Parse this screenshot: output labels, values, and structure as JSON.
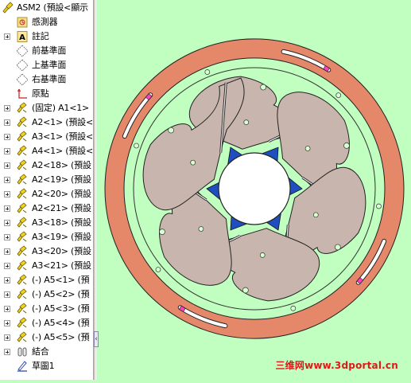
{
  "tree": {
    "items": [
      {
        "label": "ASM2 (預設<顯示",
        "icon": "assembly-icon",
        "expander": "none"
      },
      {
        "label": "感測器",
        "icon": "sensors-icon",
        "expander": "none"
      },
      {
        "label": "註記",
        "icon": "annotations-icon",
        "expander": "plus"
      },
      {
        "label": "前基準面",
        "icon": "plane-icon",
        "expander": "none"
      },
      {
        "label": "上基準面",
        "icon": "plane-icon",
        "expander": "none"
      },
      {
        "label": "右基準面",
        "icon": "plane-icon",
        "expander": "none"
      },
      {
        "label": "原點",
        "icon": "origin-icon",
        "expander": "none"
      },
      {
        "label": "(固定) A1<1>",
        "icon": "part-icon",
        "expander": "plus"
      },
      {
        "label": "A2<1> (預設<",
        "icon": "part-icon",
        "expander": "plus"
      },
      {
        "label": "A3<1> (預設<",
        "icon": "part-icon",
        "expander": "plus"
      },
      {
        "label": "A4<1> (預設<",
        "icon": "part-icon",
        "expander": "plus"
      },
      {
        "label": "A2<18> (預設",
        "icon": "part-icon",
        "expander": "plus"
      },
      {
        "label": "A2<19> (預設",
        "icon": "part-icon",
        "expander": "plus"
      },
      {
        "label": "A2<20> (預設",
        "icon": "part-icon",
        "expander": "plus"
      },
      {
        "label": "A2<21> (預設",
        "icon": "part-icon",
        "expander": "plus"
      },
      {
        "label": "A3<18> (預設",
        "icon": "part-icon",
        "expander": "plus"
      },
      {
        "label": "A3<19> (預設",
        "icon": "part-icon",
        "expander": "plus"
      },
      {
        "label": "A3<20> (預設",
        "icon": "part-icon",
        "expander": "plus"
      },
      {
        "label": "A3<21> (預設",
        "icon": "part-icon",
        "expander": "plus"
      },
      {
        "label": "(-) A5<1> (預",
        "icon": "part-icon",
        "expander": "plus"
      },
      {
        "label": "(-) A5<2> (預",
        "icon": "part-icon",
        "expander": "plus"
      },
      {
        "label": "(-) A5<3> (預",
        "icon": "part-icon",
        "expander": "plus"
      },
      {
        "label": "(-) A5<4> (預",
        "icon": "part-icon",
        "expander": "plus"
      },
      {
        "label": "(-) A5<5> (預",
        "icon": "part-icon",
        "expander": "plus"
      },
      {
        "label": "結合",
        "icon": "mates-icon",
        "expander": "plus"
      },
      {
        "label": "草圖1",
        "icon": "sketch-icon",
        "expander": "none"
      }
    ]
  },
  "watermark": {
    "text": "三维网www.3dportal.cn"
  },
  "colors": {
    "background": "#c0ffc0",
    "ring": "#e5886a",
    "blade": "#c8b6ae",
    "hub_accent": "#1f4fbf",
    "watermark": "#e01818"
  }
}
